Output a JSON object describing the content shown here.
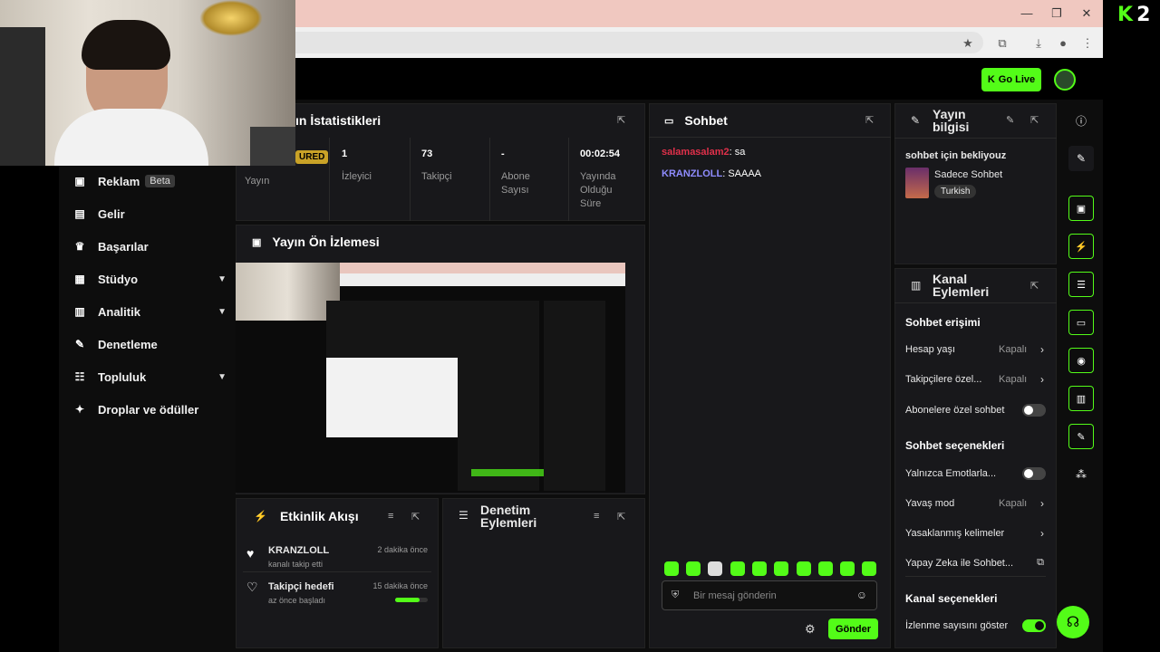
{
  "brand": {
    "logo_k": "K",
    "logo_num": "2",
    "accent": "#53fc18"
  },
  "topbar": {
    "go_live": "Go Live"
  },
  "sidebar": {
    "items": [
      {
        "label": "Reklam",
        "badge": "Beta",
        "icon": "megaphone-icon"
      },
      {
        "label": "Gelir",
        "icon": "wallet-icon"
      },
      {
        "label": "Başarılar",
        "icon": "trophy-icon"
      },
      {
        "label": "Stüdyo",
        "icon": "studio-icon",
        "expand": true
      },
      {
        "label": "Analitik",
        "icon": "chart-icon",
        "expand": true
      },
      {
        "label": "Denetleme",
        "icon": "wrench-icon"
      },
      {
        "label": "Topluluk",
        "icon": "community-icon",
        "expand": true
      },
      {
        "label": "Droplar ve ödüller",
        "icon": "gift-icon"
      }
    ]
  },
  "stats": {
    "title": "Yayın İstatistikleri",
    "title_visible": "ın İstatistikleri",
    "featured": "URED",
    "first_label": "Yayın",
    "cells": [
      {
        "value": "1",
        "label": "İzleyici"
      },
      {
        "value": "73",
        "label": "Takipçi"
      },
      {
        "value": "-",
        "label": "Abone Sayısı"
      },
      {
        "value": "00:02:54",
        "label": "Yayında Olduğu Süre"
      }
    ]
  },
  "preview": {
    "title": "Yayın Ön İzlemesi"
  },
  "activity": {
    "title": "Etkinlik Akışı",
    "items": [
      {
        "name": "KRANZLOLL",
        "sub": "kanalı takip etti",
        "time": "2 dakika önce"
      },
      {
        "name": "Takipçi hedefi",
        "sub": "az önce başladı",
        "time": "15 dakika önce",
        "progress": 0.75
      }
    ]
  },
  "moderation": {
    "title": "Denetim Eylemleri"
  },
  "chat": {
    "title": "Sohbet",
    "messages": [
      {
        "user": "salamasalam2",
        "text": ": sa",
        "color": "#e0304a"
      },
      {
        "user": "KRANZLOLL",
        "text": ": SAAAA",
        "color": "#8f8cff"
      }
    ],
    "placeholder": "Bir mesaj gönderin",
    "send": "Gönder"
  },
  "stream_info": {
    "title": "Yayın bilgisi",
    "title_line1": "Yayın",
    "title_line2": "bilgisi",
    "stream_title": "sohbet için bekliyouz",
    "category": "Sadece Sohbet",
    "tag": "Turkish"
  },
  "channel_actions": {
    "title_line1": "Kanal",
    "title_line2": "Eylemleri",
    "chat_access": "Sohbet erişimi",
    "rows_access": [
      {
        "label": "Hesap yaşı",
        "value": "Kapalı"
      },
      {
        "label": "Takipçilere özel...",
        "value": "Kapalı"
      }
    ],
    "sub_only": "Abonelere özel sohbet",
    "chat_options": "Sohbet seçenekleri",
    "emote_only": "Yalnızca Emotlarla...",
    "slow_mode": {
      "label": "Yavaş mod",
      "value": "Kapalı"
    },
    "banned_words": "Yasaklanmış kelimeler",
    "ai_chat": "Yapay Zeka ile Sohbet...",
    "channel_options": "Kanal seçenekleri",
    "viewer_count": "İzlenme sayısını göster"
  }
}
